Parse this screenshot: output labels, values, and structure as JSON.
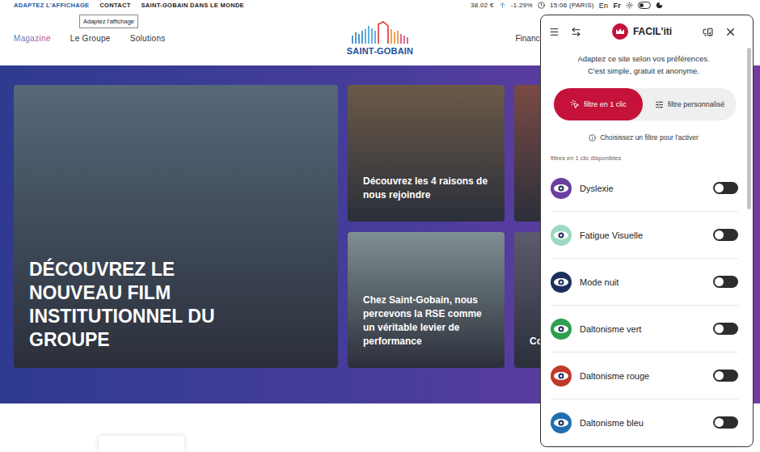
{
  "topbar": {
    "links": [
      {
        "label": "ADAPTEZ L'AFFICHAGE",
        "selected": true
      },
      {
        "label": "CONTACT",
        "selected": false
      },
      {
        "label": "SAINT-GOBAIN DANS LE MONDE",
        "selected": false
      }
    ],
    "stock": {
      "price": "38.02 €",
      "change": "-1.29%"
    },
    "time": "15:06 (PARIS)",
    "languages": [
      {
        "label": "En",
        "selected": false
      },
      {
        "label": "Fr",
        "selected": true
      }
    ],
    "dark_mode": {
      "on": false
    }
  },
  "tooltip": {
    "text": "Adaptez l'affichage"
  },
  "nav": {
    "items": [
      {
        "label": "Magazine",
        "selected": true
      },
      {
        "label": "Le Groupe",
        "selected": false
      },
      {
        "label": "Solutions",
        "selected": false
      }
    ],
    "logo": "SAINT-GOBAIN",
    "right_items": [
      "Finance"
    ]
  },
  "hero": {
    "cards": [
      {
        "kind": "large",
        "title": "DÉCOUVREZ LE NOUVEAU FILM INSTITUTIONNEL DU GROUPE",
        "color": "#56687a"
      },
      {
        "kind": "small",
        "title": "Découvrez les 4 raisons de nous rejoindre",
        "color": "#6b5a48"
      },
      {
        "kind": "image",
        "color": "#7a4a44"
      },
      {
        "kind": "small",
        "title": "Chez Saint-Gobain, nous percevons la RSE comme un véritable levier de performance",
        "color": "#7f8f92"
      },
      {
        "kind": "small",
        "title": "Co",
        "color": "#5c5a6e"
      }
    ]
  },
  "panel": {
    "title": "FACIL'iti",
    "intro": [
      "Adaptez ce site selon vos préférences.",
      "C'est simple, gratuit et anonyme."
    ],
    "modes": [
      {
        "label": "filtre en 1 clic",
        "selected": true
      },
      {
        "label": "filtre personnalisé",
        "selected": false
      }
    ],
    "hint": "Choisissez un filtre pour l'activer",
    "section_label": "filtres en 1 clic disponibles",
    "filters": [
      {
        "label": "Dyslexie",
        "on": false,
        "color": "#6a3fa0"
      },
      {
        "label": "Fatigue Visuelle",
        "on": false,
        "color": "#9fd8c0"
      },
      {
        "label": "Mode nuit",
        "on": false,
        "color": "#1d2f5c"
      },
      {
        "label": "Daltonisme vert",
        "on": false,
        "color": "#2e9e4f"
      },
      {
        "label": "Daltonisme rouge",
        "on": false,
        "color": "#c0392b"
      },
      {
        "label": "Daltonisme bleu",
        "on": false,
        "color": "#1f6fb0"
      }
    ]
  }
}
